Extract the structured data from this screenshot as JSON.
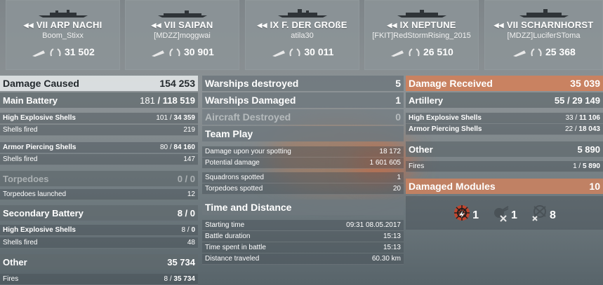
{
  "ships": [
    {
      "name": "VII ARP NACHI",
      "player": "Boom_Stixx",
      "xp": "31 502"
    },
    {
      "name": "VII SAIPAN",
      "player": "[MDZZ]moggwai",
      "xp": "30 901"
    },
    {
      "name": "IX F. DER GROßE",
      "player": "atila30",
      "xp": "30 011"
    },
    {
      "name": "IX NEPTUNE",
      "player": "[FKIT]RedStormRising_2015",
      "xp": "26 510"
    },
    {
      "name": "VII SCHARNHORST",
      "player": "[MDZZ]LuciferSToma",
      "xp": "25 368"
    }
  ],
  "damage_caused": {
    "label": "Damage Caused",
    "value": "154 253",
    "main_battery": {
      "label": "Main Battery",
      "hits": "181",
      "total": "118 519"
    },
    "he_shells": {
      "label": "High Explosive Shells",
      "hits": "101",
      "total": "34 359"
    },
    "he_fired": {
      "label": "Shells fired",
      "value": "219"
    },
    "ap_shells": {
      "label": "Armor Piercing Shells",
      "hits": "80",
      "total": "84 160"
    },
    "ap_fired": {
      "label": "Shells fired",
      "value": "147"
    },
    "torpedoes": {
      "label": "Torpedoes",
      "value": "0 / 0"
    },
    "torp_launched": {
      "label": "Torpedoes launched",
      "value": "12"
    },
    "secondary": {
      "label": "Secondary Battery",
      "hits": "8",
      "total": "0"
    },
    "sec_he": {
      "label": "High Explosive Shells",
      "hits": "8",
      "total": "0"
    },
    "sec_fired": {
      "label": "Shells fired",
      "value": "48"
    },
    "other": {
      "label": "Other",
      "value": "35 734"
    },
    "fires": {
      "label": "Fires",
      "hits": "8",
      "total": "35 734"
    }
  },
  "middle": {
    "warships_destroyed": {
      "label": "Warships destroyed",
      "value": "5"
    },
    "warships_damaged": {
      "label": "Warships Damaged",
      "value": "1"
    },
    "aircraft_destroyed": {
      "label": "Aircraft Destroyed",
      "value": "0"
    },
    "team_play": {
      "label": "Team Play"
    },
    "spot_dmg": {
      "label": "Damage upon your spotting",
      "value": "18 172"
    },
    "potential": {
      "label": "Potential damage",
      "value": "1 601 605"
    },
    "squadrons": {
      "label": "Squadrons spotted",
      "value": "1"
    },
    "torp_spotted": {
      "label": "Torpedoes spotted",
      "value": "20"
    },
    "time_dist": {
      "label": "Time and Distance"
    },
    "start": {
      "label": "Starting time",
      "value": "09:31  08.05.2017"
    },
    "duration": {
      "label": "Battle duration",
      "value": "15:13"
    },
    "spent": {
      "label": "Time spent in battle",
      "value": "15:13"
    },
    "distance": {
      "label": "Distance traveled",
      "value": "60.30 km"
    }
  },
  "damage_received": {
    "label": "Damage Received",
    "value": "35 039",
    "artillery": {
      "label": "Artillery",
      "hits": "55",
      "total": "29 149"
    },
    "he": {
      "label": "High Explosive Shells",
      "hits": "33",
      "total": "11 106"
    },
    "ap": {
      "label": "Armor Piercing Shells",
      "hits": "22",
      "total": "18 043"
    },
    "other": {
      "label": "Other",
      "value": "5 890"
    },
    "fires": {
      "label": "Fires",
      "hits": "1",
      "total": "5 890"
    },
    "modules": {
      "label": "Damaged Modules",
      "value": "10"
    },
    "mod_counts": {
      "steering": "1",
      "guns": "1",
      "aa": "8"
    }
  },
  "colors": {
    "accent_orange": "#c98261"
  }
}
